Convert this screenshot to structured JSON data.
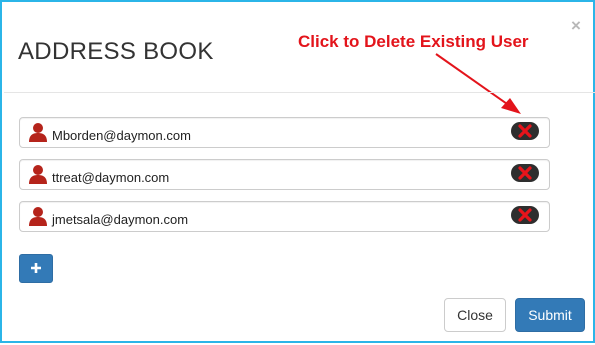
{
  "dialog": {
    "title": "ADDRESS BOOK",
    "close_glyph": "×"
  },
  "annotation": {
    "text": "Click to Delete Existing User",
    "color": "#e3141b"
  },
  "users": [
    {
      "email": "Mborden@daymon.com",
      "icon": "user-icon",
      "delete_icon": "delete-x-icon"
    },
    {
      "email": "ttreat@daymon.com",
      "icon": "user-icon",
      "delete_icon": "delete-x-icon"
    },
    {
      "email": "jmetsala@daymon.com",
      "icon": "user-icon",
      "delete_icon": "delete-x-icon"
    }
  ],
  "add_button": {
    "icon": "plus-icon"
  },
  "footer": {
    "close_label": "Close",
    "submit_label": "Submit"
  },
  "colors": {
    "frame_border": "#2bb5e8",
    "primary": "#337ab7",
    "user_icon": "#b5241b",
    "delete_x": "#e8141b",
    "delete_pill": "#2e2e2e"
  }
}
